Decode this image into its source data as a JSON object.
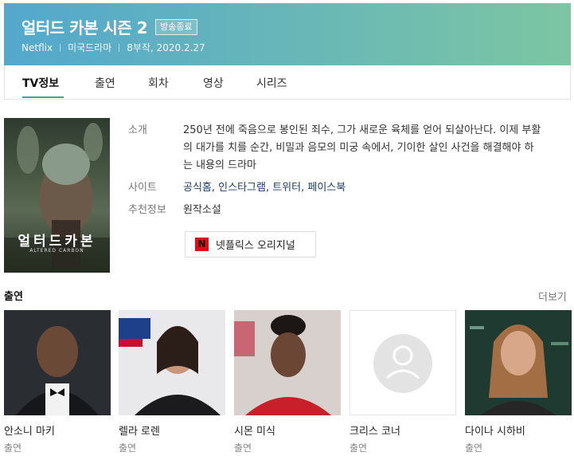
{
  "show": {
    "title": "얼터드 카본 시즌 2",
    "status_badge": "방송종료",
    "platform": "Netflix",
    "genre": "미국드라마",
    "episodes_date": "8부작, 2020.2.27"
  },
  "tabs": [
    "TV정보",
    "출연",
    "회차",
    "영상",
    "시리즈"
  ],
  "poster": {
    "title": "얼터드카본",
    "subtitle": "ALTERED CARBON"
  },
  "info": {
    "intro_label": "소개",
    "intro_text": "250년 전에 죽음으로 봉인된 죄수, 그가 새로운 육체를 얻어 되살아난다. 이제 부활의 대가를 치를 순간, 비밀과 음모의 미궁 속에서, 기이한 살인 사건을 해결해야 하는 내용의 드라마",
    "site_label": "사이트",
    "site_links": "공식홈, 인스타그램, 트위터, 페이스북",
    "recommend_label": "추천정보",
    "recommend_value": "원작소설"
  },
  "netflix_button": {
    "logo": "N",
    "label": "넷플릭스 오리지널"
  },
  "cast_section": {
    "heading": "출연",
    "more": "더보기",
    "members": [
      {
        "name": "안소니 마키",
        "role": "출연"
      },
      {
        "name": "렐라 로렌",
        "role": "출연"
      },
      {
        "name": "시몬 미식",
        "role": "출연"
      },
      {
        "name": "크리스 코너",
        "role": "출연"
      },
      {
        "name": "다이나 시하비",
        "role": "출연"
      }
    ]
  },
  "colors": {
    "header_start": "#53a8cd",
    "header_end": "#7cc6a3",
    "tab_accent": "#3ea6a0",
    "netflix_red": "#e50914"
  }
}
